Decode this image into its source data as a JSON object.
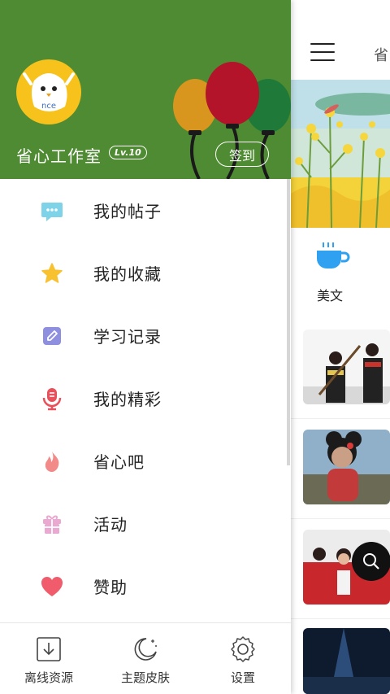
{
  "profile": {
    "username": "省心工作室",
    "level": "Lv.10",
    "checkin_label": "签到",
    "avatar_text": "nce",
    "header_color": "#4f8b32"
  },
  "menu": {
    "items": [
      {
        "label": "我的帖子",
        "icon": "chat-bubble-icon",
        "color": "#7fd3e8"
      },
      {
        "label": "我的收藏",
        "icon": "star-icon",
        "color": "#f7c12f"
      },
      {
        "label": "学习记录",
        "icon": "edit-note-icon",
        "color": "#8f8fe0"
      },
      {
        "label": "我的精彩",
        "icon": "microphone-icon",
        "color": "#e8505b"
      },
      {
        "label": "省心吧",
        "icon": "flame-icon",
        "color": "#f28a8a"
      },
      {
        "label": "活动",
        "icon": "gift-icon",
        "color": "#e9a9d0"
      },
      {
        "label": "赞助",
        "icon": "heart-icon",
        "color": "#f05c6c"
      }
    ]
  },
  "bottom_bar": {
    "offline": "离线资源",
    "theme": "主题皮肤",
    "settings": "设置"
  },
  "underlay": {
    "title": "省",
    "category_label": "美文",
    "accent": "#2fa1f0"
  }
}
